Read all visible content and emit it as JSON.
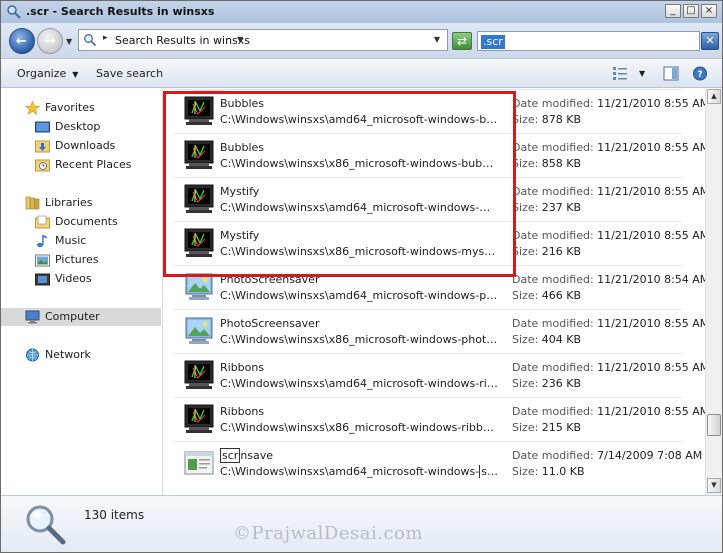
{
  "window": {
    "title": ".scr - Search Results in winsxs",
    "minimize": "_",
    "maximize": "□",
    "close": "×"
  },
  "address": {
    "breadcrumb": "Search Results in winsxs",
    "search_value": ".scr"
  },
  "toolbar": {
    "organize_label": "Organize",
    "save_search_label": "Save search"
  },
  "nav": {
    "favorites": "Favorites",
    "desktop": "Desktop",
    "downloads": "Downloads",
    "recent_places": "Recent Places",
    "libraries": "Libraries",
    "documents": "Documents",
    "music": "Music",
    "pictures": "Pictures",
    "videos": "Videos",
    "computer": "Computer",
    "network": "Network"
  },
  "labels": {
    "date_modified": "Date modified:",
    "size": "Size:"
  },
  "results": [
    {
      "name": "Bubbles",
      "path": "C:\\Windows\\winsxs\\amd64_microsoft-windows-bubbles...",
      "date": "11/21/2010 8:55 AM",
      "size": "878 KB",
      "icon": "screensaver-monitor-icon"
    },
    {
      "name": "Bubbles",
      "path": "C:\\Windows\\winsxs\\x86_microsoft-windows-bubbles_3...",
      "date": "11/21/2010 8:55 AM",
      "size": "858 KB",
      "icon": "screensaver-monitor-icon"
    },
    {
      "name": "Mystify",
      "path": "C:\\Windows\\winsxs\\amd64_microsoft-windows-mystify...",
      "date": "11/21/2010 8:55 AM",
      "size": "237 KB",
      "icon": "screensaver-monitor-icon"
    },
    {
      "name": "Mystify",
      "path": "C:\\Windows\\winsxs\\x86_microsoft-windows-mystify_31...",
      "date": "11/21/2010 8:55 AM",
      "size": "216 KB",
      "icon": "screensaver-monitor-icon"
    },
    {
      "name": "PhotoScreensaver",
      "path": "C:\\Windows\\winsxs\\amd64_microsoft-windows-photosc...",
      "date": "11/21/2010 8:54 AM",
      "size": "466 KB",
      "icon": "photo-screensaver-icon"
    },
    {
      "name": "PhotoScreensaver",
      "path": "C:\\Windows\\winsxs\\x86_microsoft-windows-photoscre...",
      "date": "11/21/2010 8:55 AM",
      "size": "404 KB",
      "icon": "photo-screensaver-icon"
    },
    {
      "name": "Ribbons",
      "path": "C:\\Windows\\winsxs\\amd64_microsoft-windows-ribbons...",
      "date": "11/21/2010 8:55 AM",
      "size": "236 KB",
      "icon": "screensaver-monitor-icon"
    },
    {
      "name": "Ribbons",
      "path": "C:\\Windows\\winsxs\\x86_microsoft-windows-ribbons_31...",
      "date": "11/21/2010 8:55 AM",
      "size": "215 KB",
      "icon": "screensaver-monitor-icon"
    },
    {
      "name_pre": "",
      "name_hl": "scr",
      "name_post": "nsave",
      "path_pre": "C:\\Windows\\winsxs\\amd64_microsoft-windows-",
      "path_hl": "scr",
      "path_post": "nsav...",
      "date": "7/14/2009 7:08 AM",
      "size": "11.0 KB",
      "icon": "dialog-window-icon"
    }
  ],
  "details": {
    "item_count": "130 items",
    "watermark": "©PrajwalDesai.com"
  },
  "colors": {
    "highlight_box": "#d51a1a",
    "search_selection": "#3178d4"
  }
}
